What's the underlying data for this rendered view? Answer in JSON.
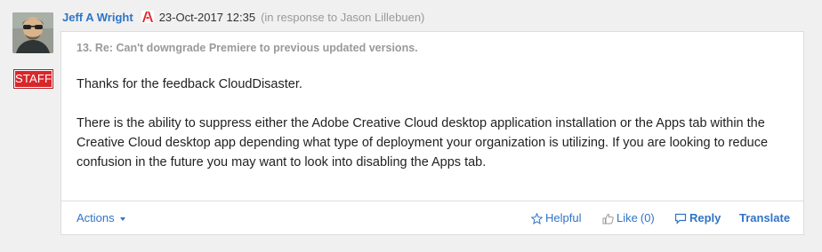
{
  "post": {
    "author": "Jeff A Wright",
    "timestamp": "23-Oct-2017 12:35",
    "in_response_to": "(in response to Jason Lillebuen)",
    "staff_badge": "STAFF",
    "subject": "13. Re: Can't downgrade Premiere to previous updated versions.",
    "body": {
      "p1": "Thanks for the feedback CloudDisaster.",
      "p2": "There is the ability to suppress either the Adobe Creative Cloud desktop application installation or the Apps tab within the Creative Cloud desktop app depending what type of deployment your organization is utilizing.  If you are looking to reduce confusion in the future you may want to look into disabling the Apps tab."
    }
  },
  "actions": {
    "menu_label": "Actions",
    "helpful_label": "Helpful",
    "like_label": "Like",
    "like_count": "(0)",
    "reply_label": "Reply",
    "translate_label": "Translate"
  },
  "icons": {
    "avatar": "user-avatar",
    "employee": "adobe-logo-icon",
    "helpful": "star-icon",
    "like": "thumbs-up-icon",
    "reply": "speech-bubble-icon",
    "actions": "chevron-down-icon"
  },
  "colors": {
    "link": "#2f74c7",
    "badge": "#d8262b",
    "muted": "#999999",
    "background": "#f0f0f0",
    "card_border": "#dcdcdc"
  }
}
